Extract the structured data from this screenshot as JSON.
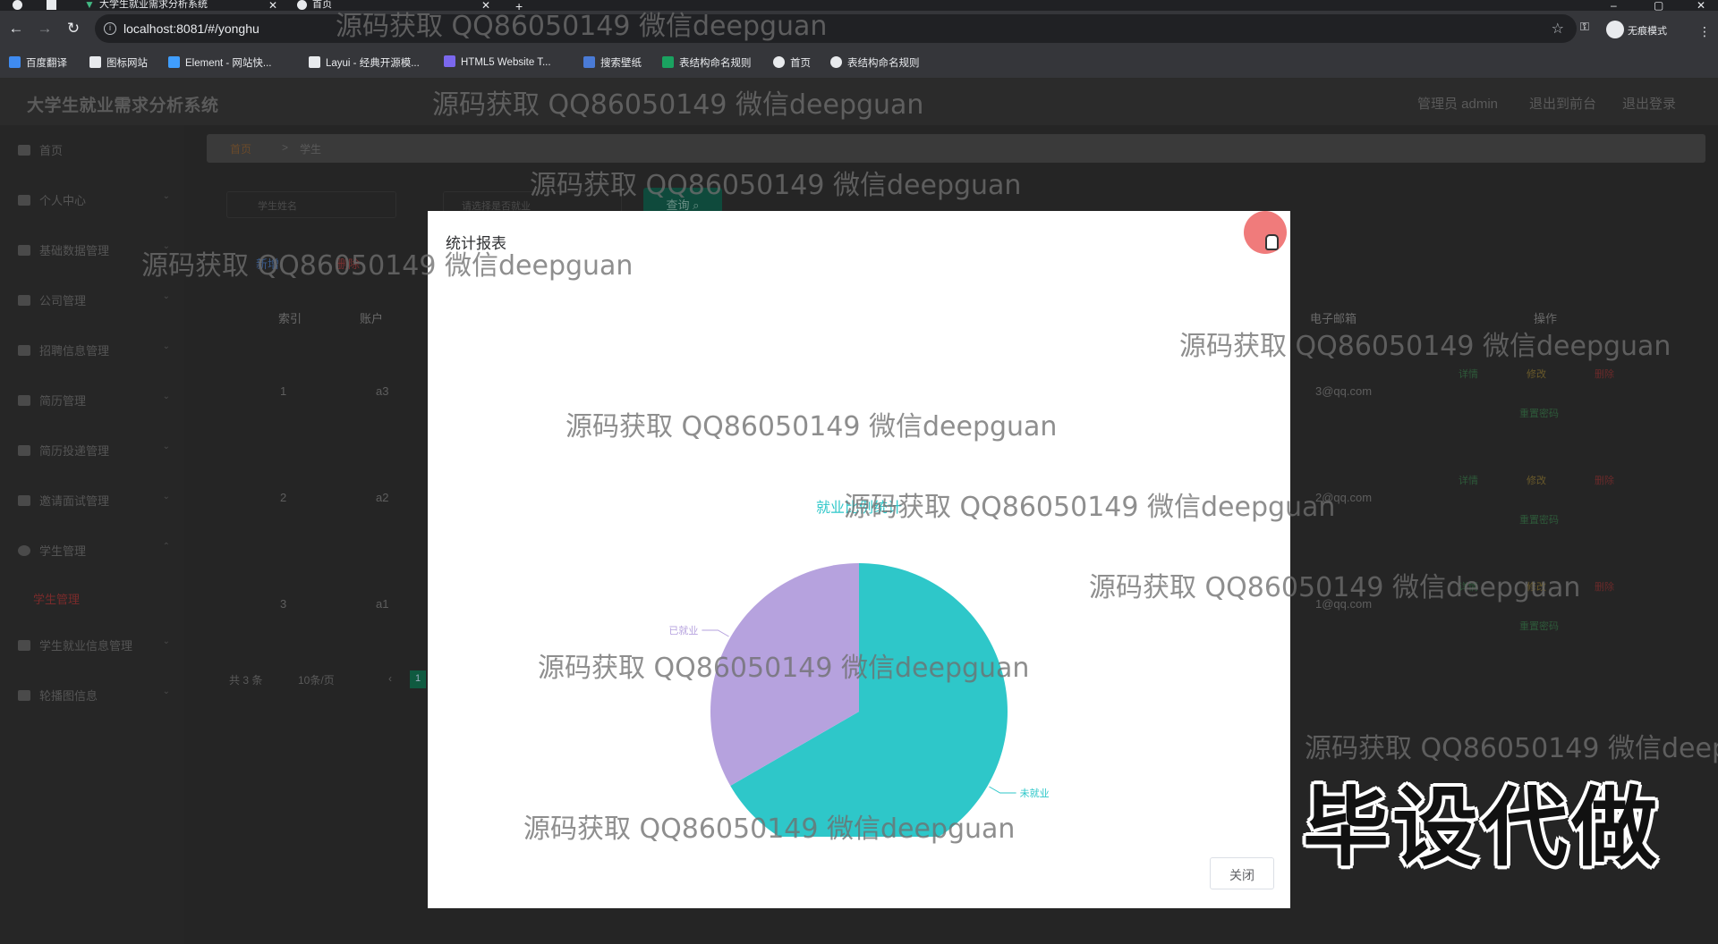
{
  "browser": {
    "tabs": [
      {
        "title": "大学生就业需求分析系统",
        "active": true
      },
      {
        "title": "首页",
        "active": false
      }
    ],
    "url": "localhost:8081/#/yonghu",
    "profile_label": "无痕模式",
    "bookmarks": [
      "百度翻译",
      "图标网站",
      "Element - 网站快...",
      "Layui - 经典开源模...",
      "HTML5 Website T...",
      "搜索壁纸",
      "表结构命名规则",
      "首页",
      "表结构命名规则"
    ]
  },
  "header": {
    "title": "大学生就业需求分析系统",
    "admin_label": "管理员 admin",
    "front_label": "退出到前台",
    "logout_label": "退出登录"
  },
  "sidebar": {
    "items": [
      "首页",
      "个人中心",
      "基础数据管理",
      "公司管理",
      "招聘信息管理",
      "简历管理",
      "简历投递管理",
      "邀请面试管理",
      "学生管理",
      "学生就业信息管理",
      "轮播图信息"
    ],
    "active_sub": "学生管理"
  },
  "main": {
    "breadcrumb": {
      "home": "首页",
      "sep": ">",
      "current": "学生"
    },
    "search_placeholder": "学生姓名",
    "select_placeholder": "请选择是否就业",
    "query_label": "查询",
    "add_label": "新增",
    "delete_label": "删除",
    "columns": {
      "index": "索引",
      "account": "账户",
      "email": "电子邮箱",
      "ops": "操作"
    },
    "rows": [
      {
        "index": "1",
        "account": "a3",
        "email": "3@qq.com"
      },
      {
        "index": "2",
        "account": "a2",
        "email": "2@qq.com"
      },
      {
        "index": "3",
        "account": "a1",
        "email": "1@qq.com"
      }
    ],
    "row_ops": {
      "detail": "详情",
      "edit": "修改",
      "delete": "删除",
      "reset": "重置密码"
    },
    "pager": {
      "total": "共 3 条",
      "size": "10条/页",
      "page": "1"
    }
  },
  "modal": {
    "title": "统计报表",
    "close_label": "关闭"
  },
  "chart_data": {
    "type": "pie",
    "title": "就业比例统计",
    "categories": [
      "未就业",
      "已就业"
    ],
    "values": [
      2,
      1
    ],
    "colors": {
      "未就业": "#2ec7c9",
      "已就业": "#b6a2de"
    }
  },
  "overlay": {
    "watermark": "源码获取 QQ86050149 微信deepguan",
    "watermark_cut": "源码获取 QQ86050149 微信deep",
    "stamp": "毕设代做"
  }
}
